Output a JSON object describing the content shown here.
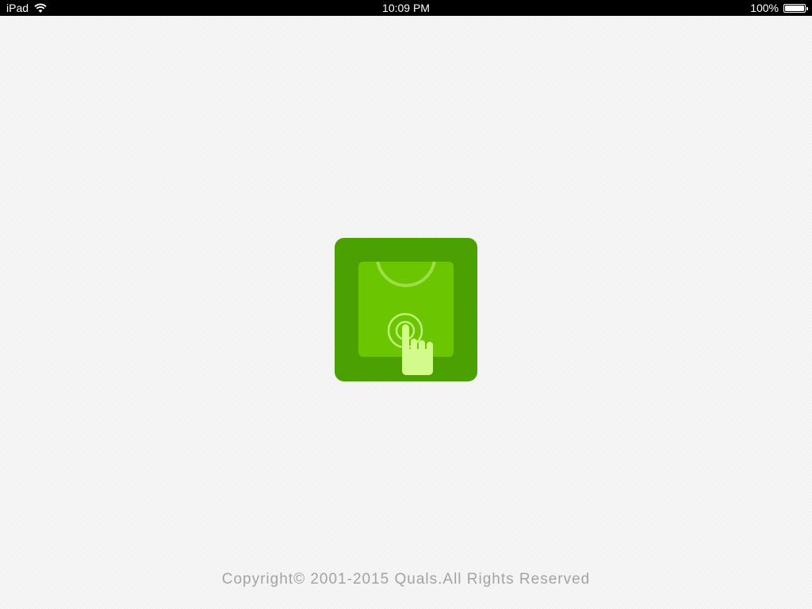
{
  "status_bar": {
    "device": "iPad",
    "time": "10:09 PM",
    "battery": "100%",
    "battery_level": 1.0
  },
  "splash": {
    "logo_icon": "hand-tap-icon",
    "brand_colors": {
      "tile": "#4ba002",
      "panel": "#6cc501",
      "hand": "#d2fb8c"
    }
  },
  "footer": {
    "copyright": "Copyright© 2001-2015 Quals.All Rights Reserved"
  }
}
